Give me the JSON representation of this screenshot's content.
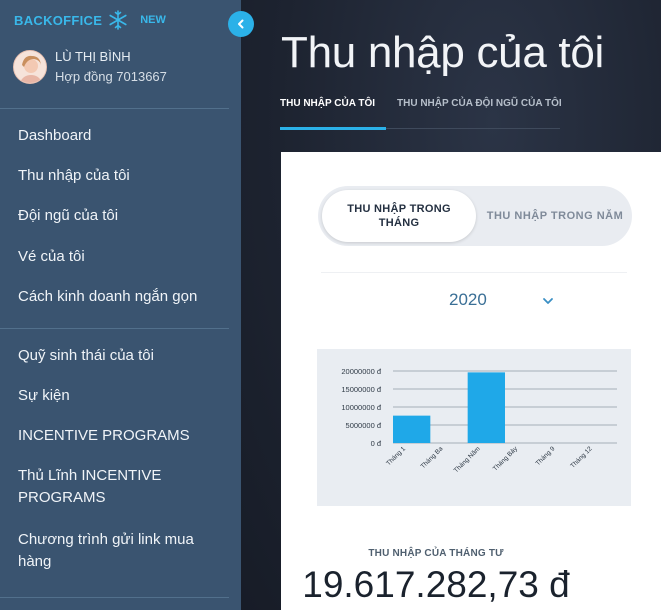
{
  "app": {
    "brand_name": "BACKOFFICE",
    "brand_badge": "NEW",
    "accent_color": "#2bb1e8",
    "sidebar_bg": "#3a5470"
  },
  "user": {
    "name": "LÙ THỊ BÌNH",
    "contract": "Hợp đồng 7013667"
  },
  "sidebar": {
    "items": [
      {
        "label": "Dashboard"
      },
      {
        "label": "Thu nhập của tôi"
      },
      {
        "label": "Đội ngũ của tôi"
      },
      {
        "label": "Vé của tôi"
      },
      {
        "label": "Cách kinh doanh ngắn gọn"
      },
      {
        "label": "Quỹ sinh thái của tôi"
      },
      {
        "label": "Sự kiện"
      },
      {
        "label": "INCENTIVE PROGRAMS"
      },
      {
        "label_line1": "Thủ Lĩnh INCENTIVE",
        "label_line2": "PROGRAMS"
      },
      {
        "label_line1": "Chương trình gửi link mua",
        "label_line2": "hàng"
      }
    ]
  },
  "main": {
    "title": "Thu nhập của tôi",
    "tabs": [
      {
        "label": "THU NHẬP CỦA TÔI",
        "active": true
      },
      {
        "label": "THU NHẬP CỦA ĐỘI NGŨ CỦA TÔI",
        "active": false
      }
    ],
    "toggle": {
      "active_line1": "THU NHẬP TRONG",
      "active_line2": "THÁNG",
      "inactive": "THU NHẬP TRONG NĂM"
    },
    "year_select": "2020",
    "income_label": "THU NHẬP CỦA THÁNG TƯ",
    "income_value": "19.617.282,73 đ"
  },
  "chart_data": {
    "type": "bar",
    "categories": [
      "Tháng 1",
      "Tháng Ba",
      "Tháng Năm",
      "Tháng Bảy",
      "Tháng 9",
      "Tháng 12"
    ],
    "values": [
      7600000,
      0,
      19617282.73,
      0,
      0,
      0
    ],
    "y_ticks": [
      "0 đ",
      "5000000 đ",
      "10000000 đ",
      "15000000 đ",
      "20000000 đ"
    ],
    "ylim": [
      0,
      20000000
    ],
    "bar_color": "#1fa8e8",
    "grid": true
  }
}
